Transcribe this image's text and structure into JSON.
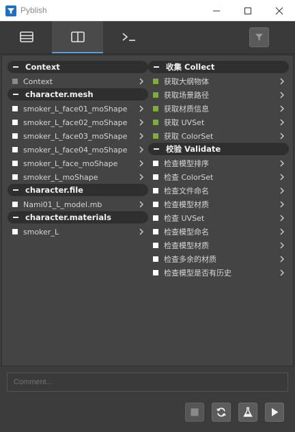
{
  "window": {
    "title": "Pyblish",
    "accent": "#5aa0d8",
    "icon": "funnel-icon"
  },
  "tabs": [
    {
      "icon": "list-icon",
      "active": false
    },
    {
      "icon": "split-view-icon",
      "active": true
    },
    {
      "icon": "terminal-icon",
      "active": false
    }
  ],
  "toolbar": {
    "filter_icon": "filter-icon"
  },
  "instances": {
    "sections": [
      {
        "label": "Context",
        "items": [
          {
            "label": "Context",
            "color": "#8a8a8a"
          }
        ]
      },
      {
        "label": "character.mesh",
        "items": [
          {
            "label": "smoker_L_face01_moShape",
            "color": "#ffffff"
          },
          {
            "label": "smoker_L_face02_moShape",
            "color": "#ffffff"
          },
          {
            "label": "smoker_L_face03_moShape",
            "color": "#ffffff"
          },
          {
            "label": "smoker_L_face04_moShape",
            "color": "#ffffff"
          },
          {
            "label": "smoker_L_face_moShape",
            "color": "#ffffff"
          },
          {
            "label": "smoker_L_moShape",
            "color": "#ffffff"
          }
        ]
      },
      {
        "label": "character.file",
        "items": [
          {
            "label": "Nami01_L_model.mb",
            "color": "#ffffff"
          }
        ]
      },
      {
        "label": "character.materials",
        "items": [
          {
            "label": "smoker_L",
            "color": "#ffffff"
          }
        ]
      }
    ]
  },
  "plugins": {
    "sections": [
      {
        "label": "收集 Collect",
        "items": [
          {
            "label": "获取大纲物体",
            "color": "#7fad3a"
          },
          {
            "label": "获取场景路径",
            "color": "#7fad3a"
          },
          {
            "label": "获取材质信息",
            "color": "#7fad3a"
          },
          {
            "label": "获取 UVSet",
            "color": "#7fad3a"
          },
          {
            "label": "获取 ColorSet",
            "color": "#7fad3a"
          }
        ]
      },
      {
        "label": "校验 Validate",
        "items": [
          {
            "label": "检查模型排序",
            "color": "#ffffff"
          },
          {
            "label": "检查 ColorSet",
            "color": "#ffffff"
          },
          {
            "label": "检查文件命名",
            "color": "#ffffff"
          },
          {
            "label": "检查模型材质",
            "color": "#ffffff"
          },
          {
            "label": "检查 UVSet",
            "color": "#ffffff"
          },
          {
            "label": "检查模型命名",
            "color": "#ffffff"
          },
          {
            "label": "检查模型材质",
            "color": "#ffffff"
          },
          {
            "label": "检查多余的材质",
            "color": "#ffffff"
          },
          {
            "label": "检查模型是否有历史",
            "color": "#ffffff"
          }
        ]
      }
    ]
  },
  "comment": {
    "placeholder": "Comment..."
  },
  "footer": {
    "buttons": [
      {
        "icon": "stop-icon"
      },
      {
        "icon": "reset-icon"
      },
      {
        "icon": "validate-flask-icon"
      },
      {
        "icon": "play-icon"
      }
    ]
  }
}
